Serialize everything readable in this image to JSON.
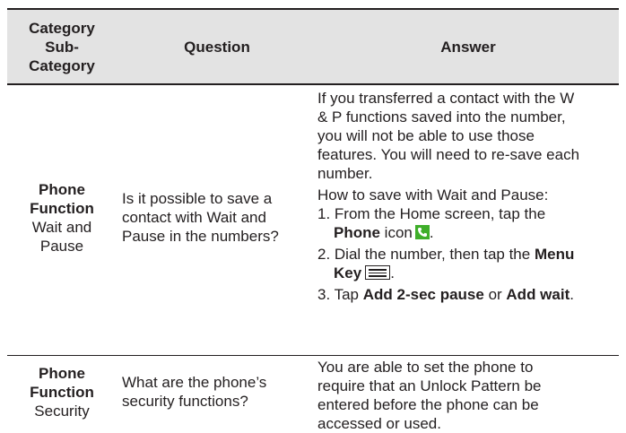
{
  "header": {
    "category": [
      "Category",
      "Sub-",
      "Category"
    ],
    "question": "Question",
    "answer": "Answer"
  },
  "rows": [
    {
      "category": "Phone",
      "category2": "Function",
      "subcategory": [
        "Wait and",
        "Pause"
      ],
      "question": [
        "Is it possible to save a",
        "contact with Wait and",
        "Pause in the numbers?"
      ],
      "answer_para": [
        "If you transferred a contact with the W",
        "& P functions saved into the number,",
        "you will not be able to use those",
        "features. You will need to re-save each",
        "number."
      ],
      "how_to": "How to save with Wait and Pause:",
      "step1_a": "1. From the Home screen, tap the",
      "step1_b_bold": "Phone",
      "step1_b_rest": " icon",
      "step1_end": ".",
      "step2_a": "2. Dial the number, then tap the",
      "step2_a_bold": "Menu",
      "step2_b_bold": "Key",
      "step2_end": ".",
      "step3_a": "3. Tap ",
      "step3_b_bold": "Add 2-sec pause",
      "step3_c": " or ",
      "step3_d_bold": "Add wait",
      "step3_end": "."
    },
    {
      "category": "Phone",
      "category2": "Function",
      "subcategory": [
        "Security"
      ],
      "question": [
        "What are the phone’s",
        "security functions?"
      ],
      "answer_para": [
        "You are able to set the phone to",
        "require that an Unlock Pattern be",
        "entered before the phone can be",
        "accessed or used."
      ]
    }
  ],
  "icons": {
    "phone": "phone-icon",
    "menu": "menu-key-icon"
  },
  "colors": {
    "header_bg": "#e3e3e3",
    "phone_icon": "#3fae2a",
    "text": "#231f20"
  }
}
